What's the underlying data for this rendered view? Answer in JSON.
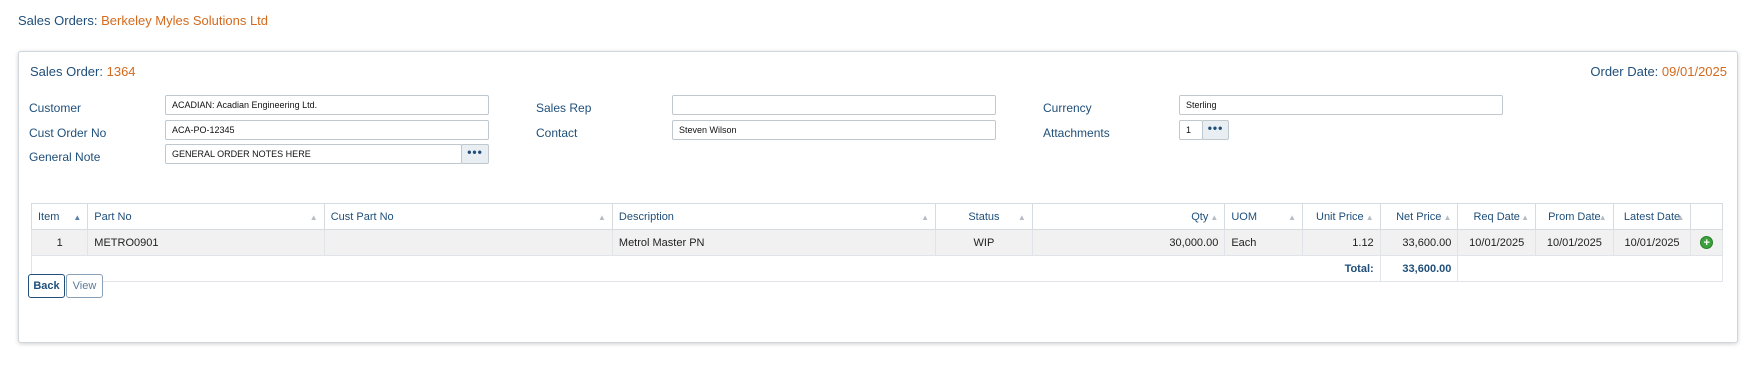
{
  "header": {
    "prefix": "Sales Orders:",
    "company": "Berkeley Myles Solutions Ltd"
  },
  "order": {
    "label": "Sales Order:",
    "number": "1364",
    "date_label": "Order Date:",
    "date": "09/01/2025"
  },
  "fields": {
    "customer": {
      "label": "Customer",
      "value": "ACADIAN: Acadian Engineering Ltd."
    },
    "cust_order_no": {
      "label": "Cust Order No",
      "value": "ACA-PO-12345"
    },
    "general_note": {
      "label": "General Note",
      "value": "GENERAL ORDER NOTES HERE"
    },
    "sales_rep": {
      "label": "Sales Rep",
      "value": ""
    },
    "contact": {
      "label": "Contact",
      "value": "Steven Wilson"
    },
    "currency": {
      "label": "Currency",
      "value": "Sterling"
    },
    "attachments": {
      "label": "Attachments",
      "value": "1"
    },
    "more_glyph": "•••"
  },
  "table": {
    "columns": [
      "Item",
      "Part No",
      "Cust Part No",
      "Description",
      "Status",
      "Qty",
      "UOM",
      "Unit Price",
      "Net Price",
      "Req Date",
      "Prom Date",
      "Latest Date"
    ],
    "rows": [
      {
        "item": "1",
        "part_no": "METRO0901",
        "cust_part_no": "",
        "description": "Metrol Master PN",
        "status": "WIP",
        "qty": "30,000.00",
        "uom": "Each",
        "unit_price": "1.12",
        "net_price": "33,600.00",
        "req_date": "10/01/2025",
        "prom_date": "10/01/2025",
        "latest_date": "10/01/2025"
      }
    ],
    "total_label": "Total:",
    "total_value": "33,600.00",
    "add_icon": "plus-circle-icon",
    "add_glyph": "+"
  },
  "buttons": {
    "back": "Back",
    "view": "View"
  },
  "colors": {
    "accent": "#d46a1e",
    "primary": "#1f4f7a",
    "add_green": "#3aa23a"
  }
}
